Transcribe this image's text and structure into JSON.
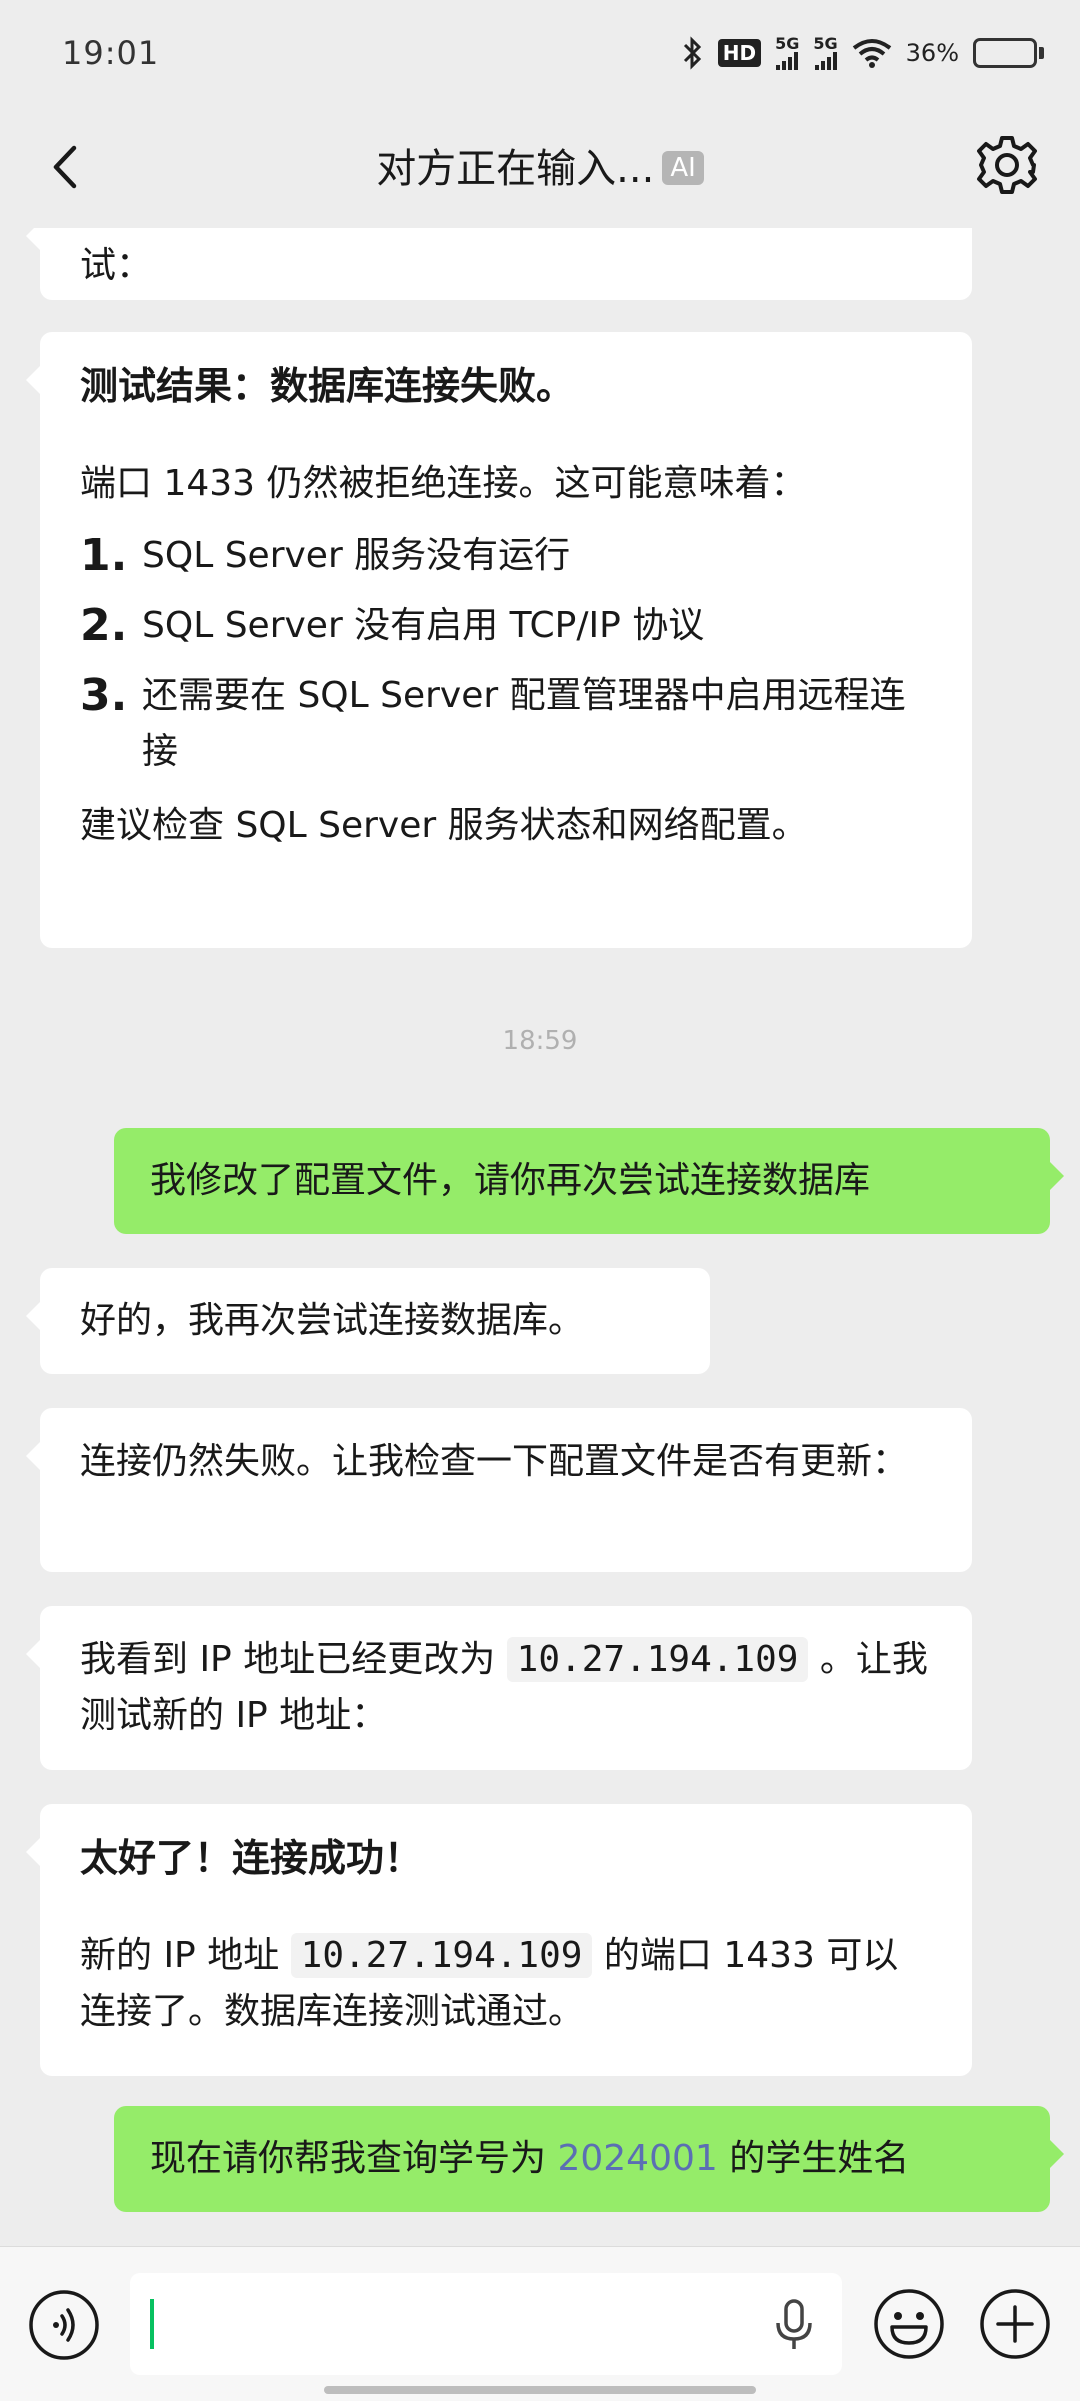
{
  "status_bar": {
    "time": "19:01",
    "hd_label": "HD",
    "net1": "5G",
    "net2": "5G",
    "battery": "36%",
    "battery_level": 0.36
  },
  "nav": {
    "title": "对方正在输入...",
    "ai_badge": "AI"
  },
  "messages": {
    "m0": {
      "text": "试："
    },
    "m1": {
      "title": "测试结果：数据库连接失败。",
      "intro": "端口 1433 仍然被拒绝连接。这可能意味着：",
      "items": [
        {
          "num": "1.",
          "text": "SQL Server 服务没有运行"
        },
        {
          "num": "2.",
          "text": "SQL Server 没有启用 TCP/IP 协议"
        },
        {
          "num": "3.",
          "text": "还需要在 SQL Server 配置管理器中启用远程连接"
        }
      ],
      "outro": "建议检查 SQL Server 服务状态和网络配置。"
    },
    "timestamp": "18:59",
    "m2": {
      "text": "我修改了配置文件，请你再次尝试连接数据库"
    },
    "m3": {
      "text": "好的，我再次尝试连接数据库。"
    },
    "m4": {
      "text": "连接仍然失败。让我检查一下配置文件是否有更新："
    },
    "m5": {
      "before": "我看到 IP 地址已经更改为 ",
      "ip": "10.27.194.109",
      "after": " 。让我测试新的 IP 地址："
    },
    "m6": {
      "title": "太好了！连接成功！",
      "before": "新的 IP 地址 ",
      "ip": "10.27.194.109",
      "after": " 的端口 1433 可以连接了。数据库连接测试通过。"
    },
    "m7": {
      "before": "现在请你帮我查询学号为 ",
      "id": "2024001",
      "after": " 的学生姓名"
    }
  },
  "icons": {
    "back": "back-arrow-icon",
    "settings": "gear-icon",
    "voice": "voice-icon",
    "mic": "microphone-icon",
    "emoji": "emoji-icon",
    "plus": "plus-icon"
  }
}
